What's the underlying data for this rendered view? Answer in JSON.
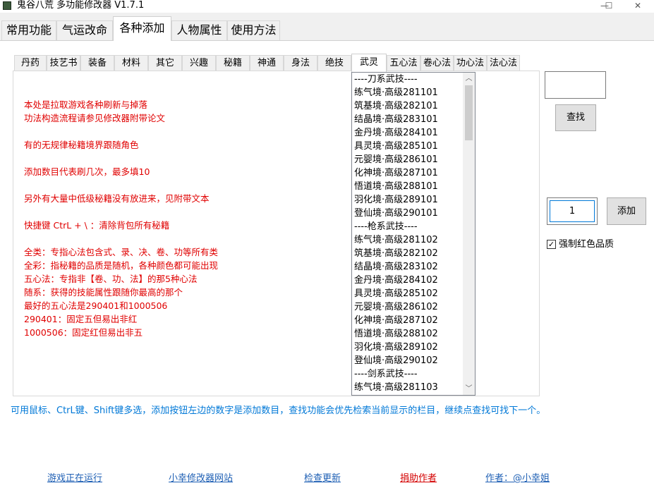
{
  "window": {
    "title": "鬼谷八荒 多功能修改器  V1.7.1",
    "min_glyph": "—",
    "max_glyph": "☐",
    "close_glyph": "✕"
  },
  "main_tabs": [
    {
      "label": "常用功能"
    },
    {
      "label": "气运改命"
    },
    {
      "label": "各种添加",
      "active": true
    },
    {
      "label": "人物属性"
    },
    {
      "label": "使用方法"
    }
  ],
  "sub_tabs": [
    {
      "label": "丹药"
    },
    {
      "label": "技艺书"
    },
    {
      "label": "装备"
    },
    {
      "label": "材料"
    },
    {
      "label": "其它"
    },
    {
      "label": "兴趣"
    },
    {
      "label": "秘籍"
    },
    {
      "label": "神通"
    },
    {
      "label": "身法"
    },
    {
      "label": "绝技"
    },
    {
      "label": "武灵",
      "active": true
    },
    {
      "label": "五心法"
    },
    {
      "label": "卷心法"
    },
    {
      "label": "功心法"
    },
    {
      "label": "法心法"
    }
  ],
  "notes": [
    "本处是拉取游戏各种刷新与掉落",
    "功法构造流程请参见修改器附带论文",
    "有的无规律秘籍境界跟随角色",
    "添加数目代表刷几次，最多填10",
    "另外有大量中低级秘籍没有放进来，见附带文本",
    "快捷键 CtrL + \\ ：清除背包所有秘籍",
    "全类：专指心法包含式、录、决、卷、功等所有类",
    "全彩：指秘籍的品质是随机，各种颜色都可能出现",
    "五心法：专指非【卷、功、法】的那5种心法",
    "随系：获得的技能属性跟随你最高的那个",
    "最好的五心法是290401和1000506",
    "290401：固定五但易出非红",
    "1000506：固定红但易出非五"
  ],
  "list_items": [
    "----刀系武技----",
    "练气境·高级281101",
    "筑基境·高级282101",
    "结晶境·高级283101",
    "金丹境·高级284101",
    "具灵境·高级285101",
    "元婴境·高级286101",
    "化神境·高级287101",
    "悟道境·高级288101",
    "羽化境·高级289101",
    "登仙境·高级290101",
    "----枪系武技----",
    "练气境·高级281102",
    "筑基境·高级282102",
    "结晶境·高级283102",
    "金丹境·高级284102",
    "具灵境·高级285102",
    "元婴境·高级286102",
    "化神境·高级287102",
    "悟道境·高级288102",
    "羽化境·高级289102",
    "登仙境·高级290102",
    "----剑系武技----",
    "练气境·高级281103"
  ],
  "scroll_up_glyph": "︿",
  "scroll_down_glyph": "﹀",
  "search": {
    "value": "",
    "button_label": "查找"
  },
  "add": {
    "count": "1",
    "button_label": "添加"
  },
  "force_red": {
    "checked": true,
    "check_glyph": "✓",
    "label": "强制红色品质"
  },
  "hint": "可用鼠标、CtrL键、Shift键多选，添加按钮左边的数字是添加数目，查找功能会优先检索当前显示的栏目，继续点查找可找下一个。",
  "footer": {
    "status": "游戏正在运行",
    "website": "小幸修改器网站",
    "update": "检查更新",
    "donate": "捐助作者",
    "author": "作者：@小幸姐"
  },
  "colors": {
    "notes": "#e00000",
    "hint": "#0078d7",
    "link_blue": "#1e5fb4",
    "link_red": "#d40000"
  }
}
